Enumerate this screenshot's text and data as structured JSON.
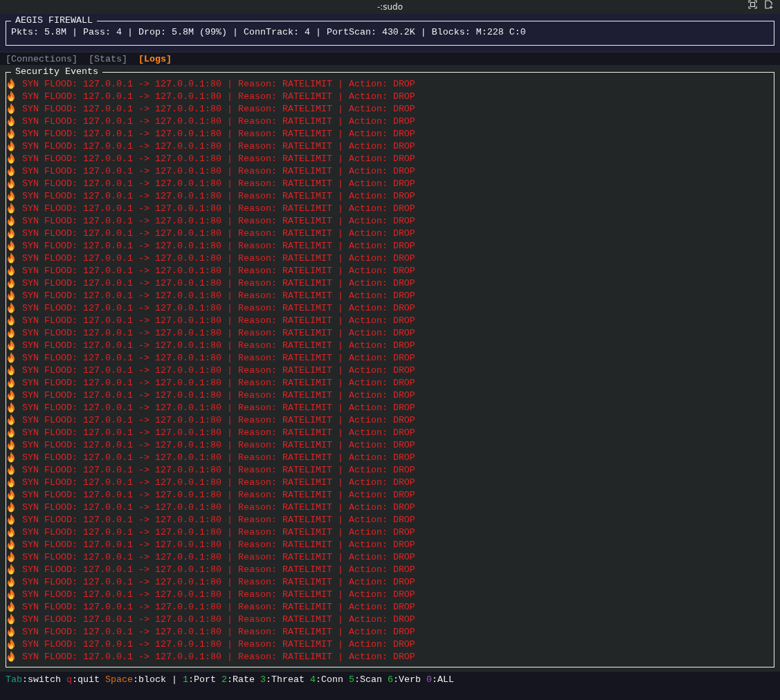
{
  "window": {
    "title": "-:sudo"
  },
  "header": {
    "title": "AEGIS FIREWALL",
    "stats": "Pkts: 5.8M | Pass: 4 | Drop: 5.8M (99%) | ConnTrack: 4 | PortScan: 430.2K | Blocks: M:228 C:0"
  },
  "tabs": [
    {
      "label": "[Connections]",
      "selected": false
    },
    {
      "label": "[Stats]",
      "selected": false
    },
    {
      "label": "[Logs]",
      "selected": true
    }
  ],
  "events": {
    "title": "Security Events",
    "rows": [
      {
        "message": "SYN FLOOD: 127.0.0.1 -> 127.0.0.1:80 | Reason: RATELIMIT | Action: DROP"
      },
      {
        "message": "SYN FLOOD: 127.0.0.1 -> 127.0.0.1:80 | Reason: RATELIMIT | Action: DROP"
      },
      {
        "message": "SYN FLOOD: 127.0.0.1 -> 127.0.0.1:80 | Reason: RATELIMIT | Action: DROP"
      },
      {
        "message": "SYN FLOOD: 127.0.0.1 -> 127.0.0.1:80 | Reason: RATELIMIT | Action: DROP"
      },
      {
        "message": "SYN FLOOD: 127.0.0.1 -> 127.0.0.1:80 | Reason: RATELIMIT | Action: DROP"
      },
      {
        "message": "SYN FLOOD: 127.0.0.1 -> 127.0.0.1:80 | Reason: RATELIMIT | Action: DROP"
      },
      {
        "message": "SYN FLOOD: 127.0.0.1 -> 127.0.0.1:80 | Reason: RATELIMIT | Action: DROP"
      },
      {
        "message": "SYN FLOOD: 127.0.0.1 -> 127.0.0.1:80 | Reason: RATELIMIT | Action: DROP"
      },
      {
        "message": "SYN FLOOD: 127.0.0.1 -> 127.0.0.1:80 | Reason: RATELIMIT | Action: DROP"
      },
      {
        "message": "SYN FLOOD: 127.0.0.1 -> 127.0.0.1:80 | Reason: RATELIMIT | Action: DROP"
      },
      {
        "message": "SYN FLOOD: 127.0.0.1 -> 127.0.0.1:80 | Reason: RATELIMIT | Action: DROP"
      },
      {
        "message": "SYN FLOOD: 127.0.0.1 -> 127.0.0.1:80 | Reason: RATELIMIT | Action: DROP"
      },
      {
        "message": "SYN FLOOD: 127.0.0.1 -> 127.0.0.1:80 | Reason: RATELIMIT | Action: DROP"
      },
      {
        "message": "SYN FLOOD: 127.0.0.1 -> 127.0.0.1:80 | Reason: RATELIMIT | Action: DROP"
      },
      {
        "message": "SYN FLOOD: 127.0.0.1 -> 127.0.0.1:80 | Reason: RATELIMIT | Action: DROP"
      },
      {
        "message": "SYN FLOOD: 127.0.0.1 -> 127.0.0.1:80 | Reason: RATELIMIT | Action: DROP"
      },
      {
        "message": "SYN FLOOD: 127.0.0.1 -> 127.0.0.1:80 | Reason: RATELIMIT | Action: DROP"
      },
      {
        "message": "SYN FLOOD: 127.0.0.1 -> 127.0.0.1:80 | Reason: RATELIMIT | Action: DROP"
      },
      {
        "message": "SYN FLOOD: 127.0.0.1 -> 127.0.0.1:80 | Reason: RATELIMIT | Action: DROP"
      },
      {
        "message": "SYN FLOOD: 127.0.0.1 -> 127.0.0.1:80 | Reason: RATELIMIT | Action: DROP"
      },
      {
        "message": "SYN FLOOD: 127.0.0.1 -> 127.0.0.1:80 | Reason: RATELIMIT | Action: DROP"
      },
      {
        "message": "SYN FLOOD: 127.0.0.1 -> 127.0.0.1:80 | Reason: RATELIMIT | Action: DROP"
      },
      {
        "message": "SYN FLOOD: 127.0.0.1 -> 127.0.0.1:80 | Reason: RATELIMIT | Action: DROP"
      },
      {
        "message": "SYN FLOOD: 127.0.0.1 -> 127.0.0.1:80 | Reason: RATELIMIT | Action: DROP"
      },
      {
        "message": "SYN FLOOD: 127.0.0.1 -> 127.0.0.1:80 | Reason: RATELIMIT | Action: DROP"
      },
      {
        "message": "SYN FLOOD: 127.0.0.1 -> 127.0.0.1:80 | Reason: RATELIMIT | Action: DROP"
      },
      {
        "message": "SYN FLOOD: 127.0.0.1 -> 127.0.0.1:80 | Reason: RATELIMIT | Action: DROP"
      },
      {
        "message": "SYN FLOOD: 127.0.0.1 -> 127.0.0.1:80 | Reason: RATELIMIT | Action: DROP"
      },
      {
        "message": "SYN FLOOD: 127.0.0.1 -> 127.0.0.1:80 | Reason: RATELIMIT | Action: DROP"
      },
      {
        "message": "SYN FLOOD: 127.0.0.1 -> 127.0.0.1:80 | Reason: RATELIMIT | Action: DROP"
      },
      {
        "message": "SYN FLOOD: 127.0.0.1 -> 127.0.0.1:80 | Reason: RATELIMIT | Action: DROP"
      },
      {
        "message": "SYN FLOOD: 127.0.0.1 -> 127.0.0.1:80 | Reason: RATELIMIT | Action: DROP"
      },
      {
        "message": "SYN FLOOD: 127.0.0.1 -> 127.0.0.1:80 | Reason: RATELIMIT | Action: DROP"
      },
      {
        "message": "SYN FLOOD: 127.0.0.1 -> 127.0.0.1:80 | Reason: RATELIMIT | Action: DROP"
      },
      {
        "message": "SYN FLOOD: 127.0.0.1 -> 127.0.0.1:80 | Reason: RATELIMIT | Action: DROP"
      },
      {
        "message": "SYN FLOOD: 127.0.0.1 -> 127.0.0.1:80 | Reason: RATELIMIT | Action: DROP"
      },
      {
        "message": "SYN FLOOD: 127.0.0.1 -> 127.0.0.1:80 | Reason: RATELIMIT | Action: DROP"
      },
      {
        "message": "SYN FLOOD: 127.0.0.1 -> 127.0.0.1:80 | Reason: RATELIMIT | Action: DROP"
      },
      {
        "message": "SYN FLOOD: 127.0.0.1 -> 127.0.0.1:80 | Reason: RATELIMIT | Action: DROP"
      },
      {
        "message": "SYN FLOOD: 127.0.0.1 -> 127.0.0.1:80 | Reason: RATELIMIT | Action: DROP"
      },
      {
        "message": "SYN FLOOD: 127.0.0.1 -> 127.0.0.1:80 | Reason: RATELIMIT | Action: DROP"
      },
      {
        "message": "SYN FLOOD: 127.0.0.1 -> 127.0.0.1:80 | Reason: RATELIMIT | Action: DROP"
      },
      {
        "message": "SYN FLOOD: 127.0.0.1 -> 127.0.0.1:80 | Reason: RATELIMIT | Action: DROP"
      },
      {
        "message": "SYN FLOOD: 127.0.0.1 -> 127.0.0.1:80 | Reason: RATELIMIT | Action: DROP"
      },
      {
        "message": "SYN FLOOD: 127.0.0.1 -> 127.0.0.1:80 | Reason: RATELIMIT | Action: DROP"
      },
      {
        "message": "SYN FLOOD: 127.0.0.1 -> 127.0.0.1:80 | Reason: RATELIMIT | Action: DROP"
      },
      {
        "message": "SYN FLOOD: 127.0.0.1 -> 127.0.0.1:80 | Reason: RATELIMIT | Action: DROP"
      }
    ]
  },
  "status_bar": [
    {
      "kind": "key",
      "key": "Tab",
      "color": "#16a085",
      "action": ":switch"
    },
    {
      "kind": "key",
      "key": "q",
      "color": "#e02020",
      "action": ":quit"
    },
    {
      "kind": "key",
      "key": "Space",
      "color": "#d9721c",
      "action": ":block"
    },
    {
      "kind": "separator",
      "text": "|"
    },
    {
      "kind": "key",
      "key": "1",
      "color": "#22c33a",
      "action": ":Port"
    },
    {
      "kind": "key",
      "key": "2",
      "color": "#22c33a",
      "action": ":Rate"
    },
    {
      "kind": "key",
      "key": "3",
      "color": "#22c33a",
      "action": ":Threat"
    },
    {
      "kind": "key",
      "key": "4",
      "color": "#22c33a",
      "action": ":Conn"
    },
    {
      "kind": "key",
      "key": "5",
      "color": "#22c33a",
      "action": ":Scan"
    },
    {
      "kind": "key",
      "key": "6",
      "color": "#22c33a",
      "action": ":Verb"
    },
    {
      "kind": "key",
      "key": "0",
      "color": "#9b59b6",
      "action": ":ALL"
    }
  ]
}
